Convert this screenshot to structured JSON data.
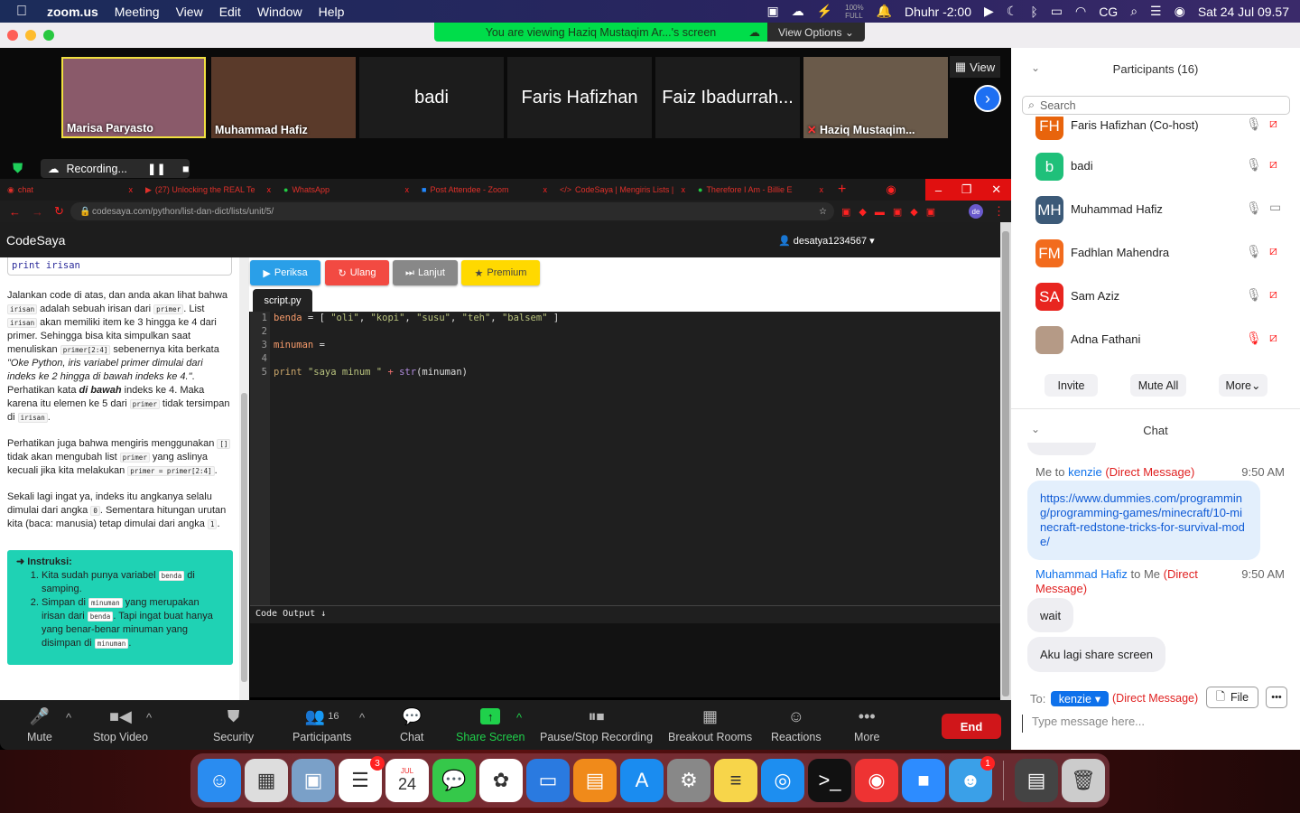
{
  "menubar": {
    "app": "zoom.us",
    "items": [
      "Meeting",
      "View",
      "Edit",
      "Window",
      "Help"
    ],
    "battery_pct": "100%",
    "battery_label": "FULL",
    "prayer": "Dhuhr -2:00",
    "user_initials": "CG",
    "datetime": "Sat 24 Jul  09.57"
  },
  "zoom": {
    "banner": "You are viewing Haziq Mustaqim Ar...'s screen",
    "view_options": "View Options",
    "view_button": "View",
    "recording": "Recording...",
    "thumbnails": [
      {
        "name": "Marisa Paryasto"
      },
      {
        "name": "Muhammad Hafiz"
      },
      {
        "name": "badi"
      },
      {
        "name": "Faris Hafizhan"
      },
      {
        "name": "Faiz Ibadurrah..."
      },
      {
        "name": "Haziq Mustaqim..."
      }
    ]
  },
  "browser": {
    "tabs": [
      "chat",
      "(27) Unlocking the REAL Te",
      "WhatsApp",
      "Post Attendee - Zoom",
      "CodeSaya | Mengiris Lists |",
      "Therefore I Am - Billie E"
    ],
    "url": "codesaya.com/python/list-dan-dict/lists/unit/5/",
    "profile": "de"
  },
  "codesaya": {
    "brand": "CodeSaya",
    "user": "desatya1234567",
    "print_line": "print irisan",
    "p1": {
      "t1": "Jalankan code di atas, dan anda akan lihat bahwa ",
      "c1": "irisan",
      "t2": " adalah sebuah irisan dari ",
      "c2": "primer",
      "t3": ". List ",
      "c3": "irisan",
      "t4": " akan memiliki item ke 3 hingga ke 4 dari primer. Sehingga bisa kita simpulkan saat menuliskan ",
      "c4": "primer[2:4]",
      "t5": " sebenernya kita berkata ",
      "i1": "\"Oke Python, iris variabel primer dimulai dari indeks ke 2 hingga di bawah indeks ke 4.\"",
      "t6": ". Perhatikan kata ",
      "b1": "di bawah",
      "t7": " indeks ke 4. Maka karena itu elemen ke 5 dari ",
      "c5": "primer",
      "t8": " tidak tersimpan di ",
      "c6": "irisan",
      "t9": "."
    },
    "p2": {
      "t1": "Perhatikan juga bahwa mengiris menggunakan ",
      "c1": "[]",
      "t2": " tidak akan mengubah list ",
      "c2": "primer",
      "t3": " yang aslinya kecuali jika kita melakukan ",
      "c3": "primer = primer[2:4]",
      "t4": "."
    },
    "p3": {
      "t1": "Sekali lagi ingat ya, indeks itu angkanya selalu dimulai dari angka ",
      "c1": "0",
      "t2": ". Sementara hitungan urutan kita (baca: manusia) tetap dimulai dari angka ",
      "c2": "1",
      "t3": "."
    },
    "instr": {
      "title": "Instruksi:",
      "s1a": "Kita sudah punya variabel ",
      "s1c": "benda",
      "s1b": " di samping.",
      "s2a": "Simpan di ",
      "s2c1": "minuman",
      "s2b": " yang merupakan irisan dari ",
      "s2c2": "benda",
      "s2d": ". Tapi ingat buat hanya yang benar-benar minuman yang disimpan di ",
      "s2c3": "minuman",
      "s2e": "."
    },
    "buttons": {
      "check": "Periksa",
      "reset": "Ulang",
      "next": "Lanjut",
      "premium": "Premium"
    },
    "file_tab": "script.py",
    "line_numbers": [
      "1",
      "2",
      "3",
      "4",
      "5"
    ],
    "code": {
      "l1_var": "benda",
      "l1_eq": " = [ ",
      "s1": "\"oli\"",
      "s2": "\"kopi\"",
      "s3": "\"susu\"",
      "s4": "\"teh\"",
      "s5": "\"balsem\"",
      "l3_var": "minuman",
      "l3_eq": " =",
      "l5_kw": "print",
      "l5_str": "\"saya minum \"",
      "l5_op": " + ",
      "l5_fn": "str",
      "l5_arg": "(minuman)"
    },
    "output_label": "Code Output"
  },
  "toolbar": {
    "mute": "Mute",
    "stop_video": "Stop Video",
    "security": "Security",
    "participants": "Participants",
    "participants_count": "16",
    "chat": "Chat",
    "share": "Share Screen",
    "recording": "Pause/Stop Recording",
    "breakout": "Breakout Rooms",
    "reactions": "Reactions",
    "more": "More",
    "end": "End"
  },
  "participants": {
    "title": "Participants (16)",
    "search_placeholder": "Search",
    "list": [
      {
        "initials": "FH",
        "name": "Faris Hafizhan (Co-host)",
        "color": "#e8640c"
      },
      {
        "initials": "b",
        "name": "badi",
        "color": "#1fc07a"
      },
      {
        "initials": "MH",
        "name": "Muhammad Hafiz",
        "color": "#3c5a78"
      },
      {
        "initials": "FM",
        "name": "Fadhlan Mahendra",
        "color": "#f26b1d"
      },
      {
        "initials": "SA",
        "name": "Sam Aziz",
        "color": "#e8251f"
      },
      {
        "initials": "",
        "name": "Adna Fathani",
        "color": "#b59a86"
      }
    ],
    "invite": "Invite",
    "mute_all": "Mute All",
    "more": "More"
  },
  "chat": {
    "title": "Chat",
    "m1": {
      "from": "Me to ",
      "to": "kenzie",
      "dm": "(Direct Message)",
      "time": "9:50 AM",
      "text": "https://www.dummies.com/programming/programming-games/minecraft/10-minecraft-redstone-tricks-for-survival-mode/"
    },
    "m2": {
      "from": "Muhammad Hafiz",
      "to": " to Me ",
      "dm": "(Direct Message)",
      "time": "9:50 AM",
      "texts": [
        "wait",
        "Aku lagi share screen"
      ]
    },
    "to_label": "To:",
    "recipient": "kenzie",
    "recipient_dm": "(Direct Message)",
    "file": "File",
    "placeholder": "Type message here..."
  },
  "dock": {
    "apps": [
      {
        "name": "finder",
        "color": "#2a8cf0",
        "glyph": "☺"
      },
      {
        "name": "launchpad",
        "color": "#ddd",
        "glyph": "▦"
      },
      {
        "name": "preview",
        "color": "#7aa0c8",
        "glyph": "▣"
      },
      {
        "name": "reminders",
        "color": "#fff",
        "glyph": "☰",
        "badge": "3"
      },
      {
        "name": "calendar",
        "color": "#fff",
        "glyph": "24",
        "label": "JUL"
      },
      {
        "name": "messages",
        "color": "#35c84a",
        "glyph": "💬"
      },
      {
        "name": "photos",
        "color": "#fff",
        "glyph": "✿"
      },
      {
        "name": "keynote",
        "color": "#2a7ae0",
        "glyph": "▭"
      },
      {
        "name": "books",
        "color": "#f08a1a",
        "glyph": "▤"
      },
      {
        "name": "app-store",
        "color": "#1a8cf0",
        "glyph": "A"
      },
      {
        "name": "system-preferences",
        "color": "#888",
        "glyph": "⚙"
      },
      {
        "name": "notes",
        "color": "#f7d54a",
        "glyph": "≡"
      },
      {
        "name": "safari",
        "color": "#1d8ef0",
        "glyph": "◎"
      },
      {
        "name": "terminal",
        "color": "#111",
        "glyph": ">_"
      },
      {
        "name": "chrome",
        "color": "#e33",
        "glyph": "◉"
      },
      {
        "name": "zoom",
        "color": "#2d8cff",
        "glyph": "■"
      },
      {
        "name": "tweetbot",
        "color": "#3aa0e8",
        "glyph": "☻",
        "badge": "1"
      },
      {
        "name": "downloads-stack",
        "color": "#444",
        "glyph": "▤"
      },
      {
        "name": "trash",
        "color": "#ccc",
        "glyph": "🗑"
      }
    ]
  }
}
